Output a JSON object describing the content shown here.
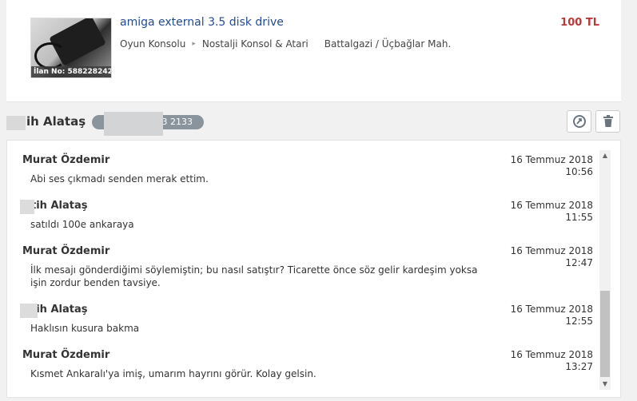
{
  "listing": {
    "title": "amiga external 3.5 disk drive",
    "ilan_no": "İlan No: 588228242",
    "category": "Oyun Konsolu",
    "subcategory": "Nostalji Konsol & Atari",
    "location": "Battalgazi / Üçbağlar Mah.",
    "price": "100 TL"
  },
  "conversation": {
    "contact_name": "ih Alataş",
    "phone_visible": "3 2133",
    "buttons": [
      "archive-icon",
      "trash-icon"
    ]
  },
  "messages": [
    {
      "author": "Murat Özdemir",
      "text": "Abi ses çıkmadı senden merak ettim.",
      "date": "16 Temmuz 2018",
      "time": "10:56"
    },
    {
      "author": "tih Alataş",
      "text": "satıldı 100e ankaraya",
      "date": "16 Temmuz 2018",
      "time": "11:55"
    },
    {
      "author": "Murat Özdemir",
      "text": "İlk mesajı gönderdiğimi söylemiştin; bu nasıl satıştır? Ticarette önce söz gelir kardeşim yoksa işin zordur benden tavsiye.",
      "date": "16 Temmuz 2018",
      "time": "12:47"
    },
    {
      "author": "tih Alataş",
      "text": "Haklısın kusura bakma",
      "date": "16 Temmuz 2018",
      "time": "12:55"
    },
    {
      "author": "Murat Özdemir",
      "text": "Kısmet Ankaralı'ya imiş, umarım hayrını görür. Kolay gelsin.",
      "date": "16 Temmuz 2018",
      "time": "13:27"
    }
  ]
}
